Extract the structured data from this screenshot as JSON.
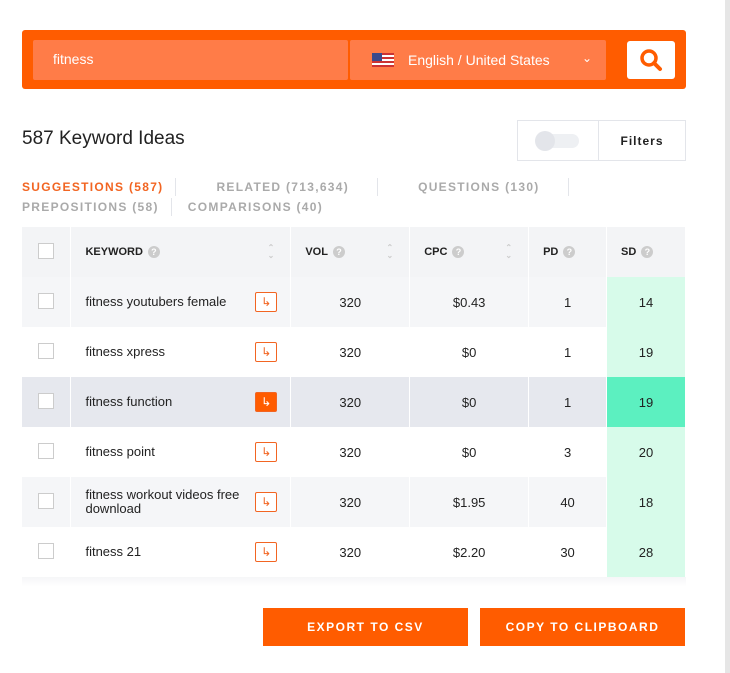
{
  "search": {
    "query": "fitness",
    "language": "English / United States"
  },
  "title": "587 Keyword Ideas",
  "filters_label": "Filters",
  "tabs": [
    {
      "label": "SUGGESTIONS (587)",
      "active": true
    },
    {
      "label": "RELATED (713,634)"
    },
    {
      "label": "QUESTIONS (130)"
    },
    {
      "label": "PREPOSITIONS (58)"
    },
    {
      "label": "COMPARISONS (40)"
    }
  ],
  "columns": [
    "KEYWORD",
    "VOL",
    "CPC",
    "PD",
    "SD"
  ],
  "rows": [
    {
      "keyword": "fitness youtubers female",
      "vol": "320",
      "cpc": "$0.43",
      "pd": "1",
      "sd": "14"
    },
    {
      "keyword": "fitness xpress",
      "vol": "320",
      "cpc": "$0",
      "pd": "1",
      "sd": "19"
    },
    {
      "keyword": "fitness function",
      "vol": "320",
      "cpc": "$0",
      "pd": "1",
      "sd": "19"
    },
    {
      "keyword": "fitness point",
      "vol": "320",
      "cpc": "$0",
      "pd": "3",
      "sd": "20"
    },
    {
      "keyword": "fitness workout videos free download",
      "vol": "320",
      "cpc": "$1.95",
      "pd": "40",
      "sd": "18"
    },
    {
      "keyword": "fitness 21",
      "vol": "320",
      "cpc": "$2.20",
      "pd": "30",
      "sd": "28"
    }
  ],
  "buttons": {
    "export": "EXPORT TO CSV",
    "copy": "COPY TO CLIPBOARD"
  },
  "colors": {
    "accent": "#ff5c00",
    "sd_easy": "#d7fbea"
  }
}
